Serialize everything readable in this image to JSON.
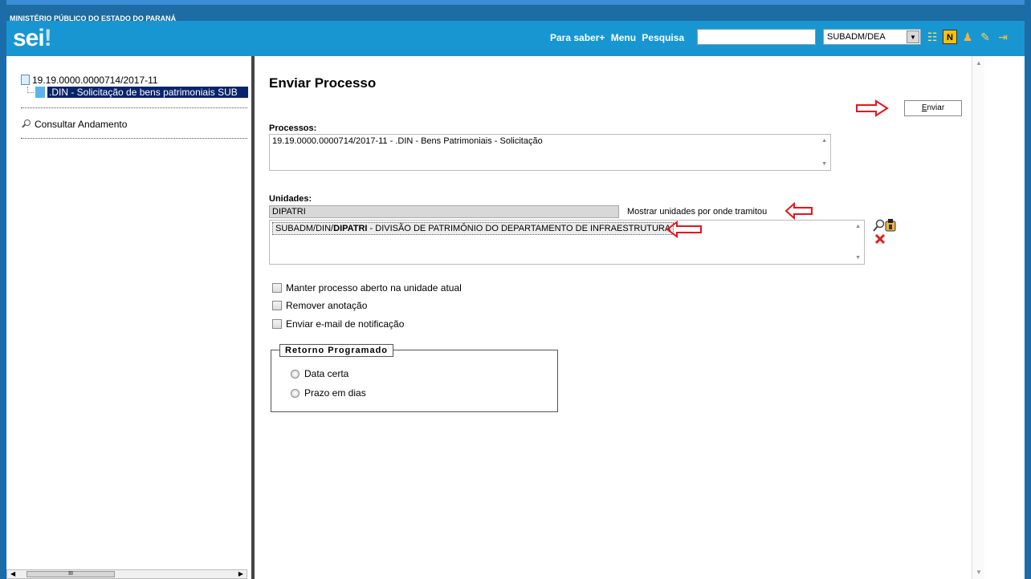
{
  "header": {
    "institution": "MINISTÉRIO PÚBLICO DO ESTADO DO PARANÁ",
    "logo": "sei",
    "logo_mark": "!",
    "nav": [
      "Para saber+",
      "Menu",
      "Pesquisa"
    ],
    "search_value": "",
    "unit_selected": "SUBADM/DEA",
    "tool_icons": [
      "list-icon",
      "notes-icon",
      "user-icon",
      "wrench-icon",
      "exit-icon"
    ]
  },
  "tree": {
    "process_number": "19.19.0000.0000714/2017-11",
    "document": ".DIN - Solicitação de bens patrimoniais SUB",
    "consultar": "Consultar Andamento"
  },
  "form": {
    "title": "Enviar Processo",
    "submit_label_prefix": "E",
    "submit_label_rest": "nviar",
    "processos_label": "Processos:",
    "processos_items": [
      "19.19.0000.0000714/2017-11 - .DIN - Bens Patrimoniais - Solicitação"
    ],
    "unidades_label": "Unidades:",
    "unidade_input": "DIPATRI",
    "mostrar_link": "Mostrar unidades por onde tramitou",
    "selected_unit_prefix": "SUBADM/DIN/",
    "selected_unit_bold": "DIPATRI",
    "selected_unit_suffix": " - DIVISÃO DE PATRIMÔNIO DO DEPARTAMENTO DE INFRAESTRUTURA",
    "checkboxes": [
      "Manter processo aberto na unidade atual",
      "Remover anotação",
      "Enviar e-mail de notificação"
    ],
    "retorno_legend": "Retorno Programado",
    "radios": [
      "Data certa",
      "Prazo em dias"
    ]
  },
  "colors": {
    "header_blue": "#1896d2",
    "institution_blue": "#1d6ca3",
    "selection_navy": "#0a246a",
    "annotation_red": "#e8141b"
  }
}
